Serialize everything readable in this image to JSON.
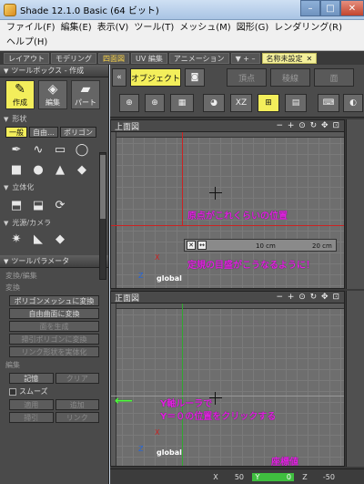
{
  "window": {
    "title": "Shade 12.1.0 Basic (64 ビット)",
    "buttons": [
      "–",
      "□",
      "✕"
    ]
  },
  "menu": [
    "ファイル(F)",
    "編集(E)",
    "表示(V)",
    "ツール(T)",
    "メッシュ(M)",
    "図形(G)",
    "レンダリング(R)",
    "ヘルプ(H)"
  ],
  "tabs": [
    {
      "label": "レイアウト"
    },
    {
      "label": "モデリング"
    },
    {
      "label": "四面図"
    },
    {
      "label": "UV 編集"
    },
    {
      "label": "アニメーション"
    },
    {
      "label": "▼ + –"
    },
    {
      "label": "名称未設定",
      "close": "✕"
    }
  ],
  "toolbox": {
    "title": "ツールボックス - 作成",
    "modes": [
      {
        "label": "作成",
        "icon": "pencil-icon"
      },
      {
        "label": "編集",
        "icon": "cube-edit-icon"
      },
      {
        "label": "パート",
        "icon": "part-icon"
      }
    ],
    "shape_section": "形状",
    "shape_tabs": [
      "一般",
      "自由…",
      "ポリゴン"
    ],
    "solid_section": "立体化",
    "light_section": "光源/カメラ"
  },
  "params": {
    "title": "ツールパラメータ",
    "convert_label": "変換/編集",
    "convert_sub": "変換",
    "buttons": [
      "ポリゴンメッシュに変換",
      "自由曲面に変換",
      "面を生成",
      "掃引ポリゴンに変換",
      "リンク形状を実体化"
    ],
    "edit_label": "編集",
    "edit_pair": [
      "記憶",
      "クリア"
    ],
    "smooth": "スムーズ",
    "apply_pair": [
      "適用",
      "追加"
    ],
    "sweep_pair": [
      "掃引",
      "リンク"
    ]
  },
  "viewport": {
    "object_button": "オブジェクト",
    "vertex": "頂点",
    "edge": "稜線",
    "face": "面",
    "xz_label": "XZ",
    "top_view_title": "上面図",
    "front_view_title": "正面図",
    "pane_tools": "− + ⊙ ↻ ✥ ⊡",
    "global": "global",
    "axis_x": "X",
    "axis_z": "Z",
    "ruler_10": "10 cm",
    "ruler_20": "20 cm",
    "annotation_origin": "原点がこれくらいの位置",
    "annotation_ruler": "定規の目盛がこうなるように！",
    "annotation_yruler": "Y軸ルーラで",
    "annotation_click": "Y＝０の位置をクリックする",
    "annotation_coord": "座標値"
  },
  "coords": {
    "x_label": "X",
    "x_value": "50",
    "y_label": "Y",
    "y_value": "0",
    "z_label": "Z",
    "z_value": "-50"
  },
  "colors": {
    "annotation": "#e020e0",
    "arrow": "#4cff3a",
    "active_yellow": "#f3ee5b",
    "axis_red": "#cc2222"
  }
}
